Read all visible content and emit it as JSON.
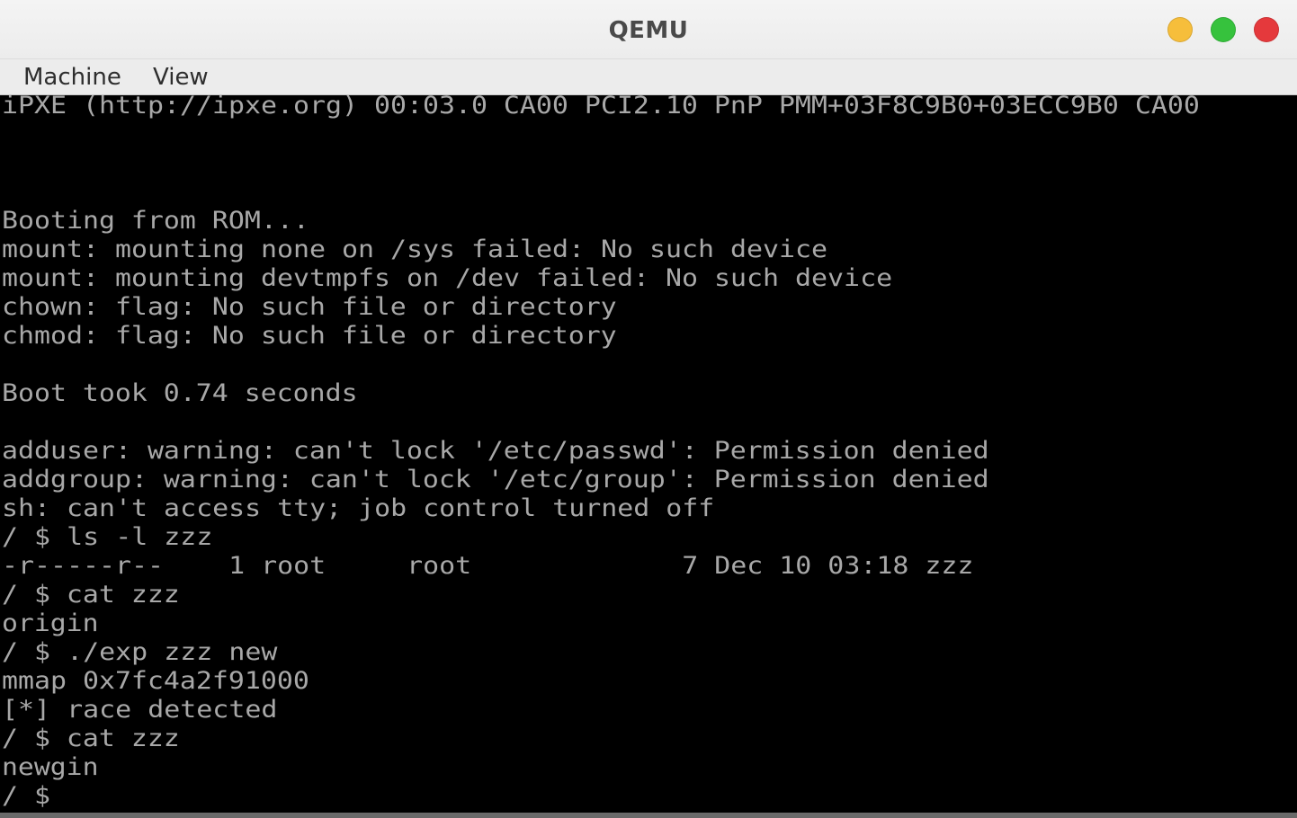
{
  "window": {
    "title": "QEMU",
    "controls": {
      "minimize_color": "#f6be3b",
      "maximize_color": "#36c23d",
      "close_color": "#e5393c"
    }
  },
  "menu": {
    "items": [
      "Machine",
      "View"
    ]
  },
  "console": {
    "text_color": "#a8a8a8",
    "background_color": "#000000",
    "lines": [
      "iPXE (http://ipxe.org) 00:03.0 CA00 PCI2.10 PnP PMM+03F8C9B0+03ECC9B0 CA00",
      "",
      "",
      "",
      "Booting from ROM...",
      "mount: mounting none on /sys failed: No such device",
      "mount: mounting devtmpfs on /dev failed: No such device",
      "chown: flag: No such file or directory",
      "chmod: flag: No such file or directory",
      "",
      "Boot took 0.74 seconds",
      "",
      "adduser: warning: can't lock '/etc/passwd': Permission denied",
      "addgroup: warning: can't lock '/etc/group': Permission denied",
      "sh: can't access tty; job control turned off",
      "/ $ ls -l zzz",
      "-r-----r--    1 root     root             7 Dec 10 03:18 zzz",
      "/ $ cat zzz",
      "origin",
      "/ $ ./exp zzz new",
      "mmap 0x7fc4a2f91000",
      "[*] race detected",
      "/ $ cat zzz",
      "newgin",
      "/ $ "
    ]
  }
}
